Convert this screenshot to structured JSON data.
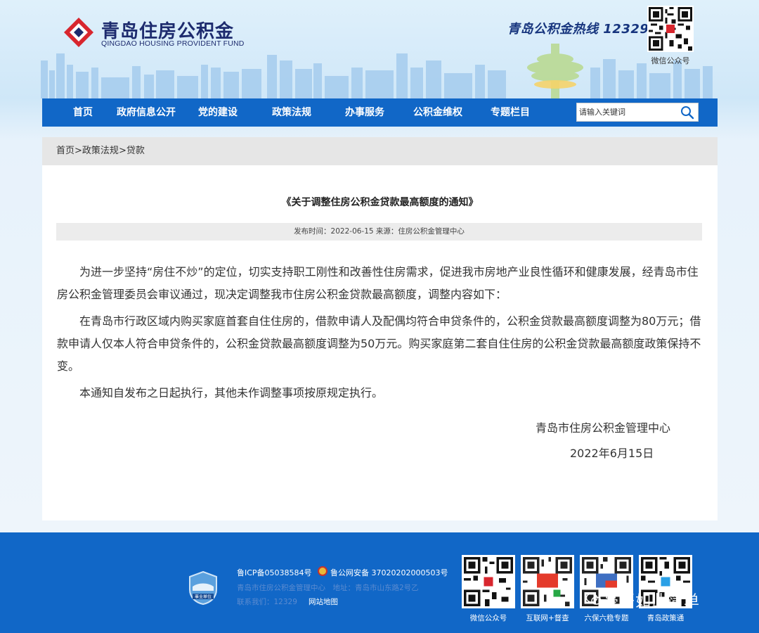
{
  "header": {
    "logo_cn": "青岛住房公积金",
    "logo_en": "QINGDAO HOUSING PROVIDENT FUND",
    "hotline": "青岛公积金热线 12329",
    "qr_caption": "微信公众号"
  },
  "nav": {
    "items": [
      "首页",
      "政府信息公开",
      "党的建设",
      "政策法规",
      "办事服务",
      "公积金维权",
      "专题栏目"
    ],
    "search_placeholder": "请输入关键词"
  },
  "breadcrumb": {
    "items": [
      "首页",
      "政策法规",
      "贷款"
    ],
    "separator": ">"
  },
  "article": {
    "title": "《关于调整住房公积金贷款最高额度的通知》",
    "meta": "发布时间：2022-06-15 来源：住房公积金管理中心",
    "paragraphs": [
      "为进一步坚持“房住不炒”的定位，切实支持职工刚性和改善性住房需求，促进我市房地产业良性循环和健康发展，经青岛市住房公积金管理委员会审议通过，现决定调整我市住房公积金贷款最高额度，调整内容如下：",
      "在青岛市行政区域内购买家庭首套自住住房的，借款申请人及配偶均符合申贷条件的，公积金贷款最高额度调整为80万元；借款申请人仅本人符合申贷条件的，公积金贷款最高额度调整为50万元。购买家庭第二套自住住房的公积金贷款最高额度政策保持不变。",
      "本通知自发布之日起执行，其他未作调整事项按原规定执行。"
    ],
    "signature": "青岛市住房公积金管理中心",
    "date": "2022年6月15日"
  },
  "footer": {
    "icp": "鲁ICP备05038584号",
    "police": "鲁公网安备 37020202000503号",
    "org_line": "青岛市住房公积金管理中心　地址：青岛市山东路2号乙",
    "contact": "联系我们：12329",
    "sitemap": "网站地图",
    "badge_label": "事业单位",
    "qr_items": [
      {
        "caption": "微信公众号"
      },
      {
        "caption": "互联网+督查",
        "badge": "国务院"
      },
      {
        "caption": "六保六稳专题"
      },
      {
        "caption": "青岛政策通"
      }
    ],
    "watermark": "豪哥如此简单"
  },
  "colors": {
    "nav_blue": "#1167c7",
    "logo_red": "#d8262e",
    "logo_navy": "#1d2b6e"
  }
}
